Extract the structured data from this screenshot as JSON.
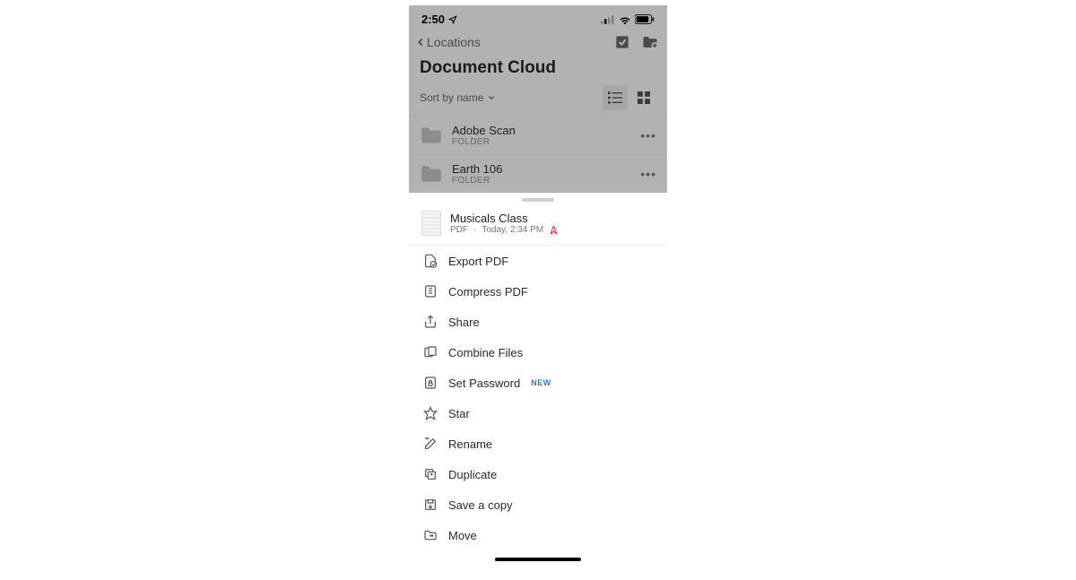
{
  "status": {
    "time": "2:50"
  },
  "nav": {
    "back_label": "Locations"
  },
  "page": {
    "title": "Document Cloud"
  },
  "sort": {
    "label": "Sort by name"
  },
  "folders": [
    {
      "name": "Adobe Scan",
      "sub": "FOLDER"
    },
    {
      "name": "Earth 106",
      "sub": "FOLDER"
    }
  ],
  "sheet": {
    "file_name": "Musicals Class",
    "meta_type": "PDF",
    "meta_time": "Today, 2:34 PM"
  },
  "actions": {
    "export": "Export PDF",
    "compress": "Compress PDF",
    "share": "Share",
    "combine": "Combine Files",
    "password": "Set Password",
    "password_badge": "NEW",
    "star": "Star",
    "rename": "Rename",
    "duplicate": "Duplicate",
    "savecopy": "Save a copy",
    "move": "Move"
  }
}
